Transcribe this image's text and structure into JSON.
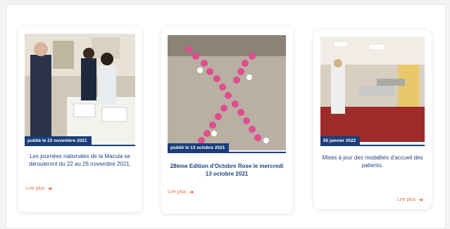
{
  "cards": [
    {
      "date": "publié le 23 novembre 2021",
      "title": "Les journées nationales de la Macula se dérouleront du 22 au 26 novembre 2021.",
      "read_more": "Lire plus",
      "icon": "arrow-right-icon"
    },
    {
      "date": "publié le 13 octobre 2021",
      "title": "28ème Edition d'Octobre Rose le mercredi 13 octobre 2021",
      "read_more": "Lire plus",
      "icon": "arrow-right-icon"
    },
    {
      "date": "05 janvier 2022",
      "title": "Mises à jour des modalités d'accueil des patients.",
      "read_more": "Lire plus",
      "icon": "arrow-right-icon"
    }
  ],
  "colors": {
    "badge": "#1a3e7a",
    "title": "#1d4286",
    "link": "#e8704a"
  }
}
